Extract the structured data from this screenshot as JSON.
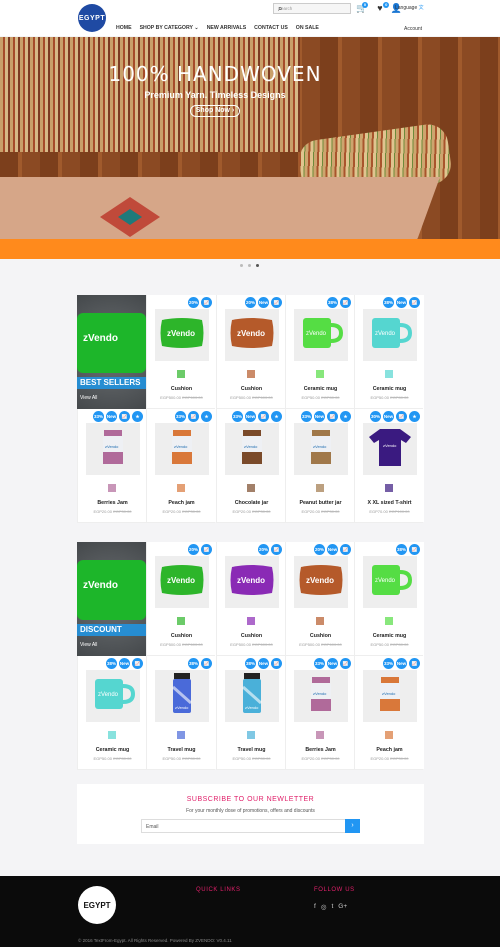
{
  "header": {
    "logo_text": "EGYPT",
    "search_placeholder": "Search",
    "cart_count": "0",
    "wishlist_count": "0",
    "language": "Language",
    "account": "Account",
    "nav": [
      "HOME",
      "SHOP BY CATEGORY ⌄",
      "NEW ARRIVALS",
      "CONTACT US",
      "ON SALE"
    ]
  },
  "hero": {
    "title": "100% HANDWOVEN",
    "subtitle": "Premium Yarn. Timeless Designs",
    "button": "Shop Now ›"
  },
  "colors": {
    "accent": "#2196f3",
    "hero_band": "#ff8a1c",
    "newsletter_title": "#e0206a"
  },
  "sections": [
    {
      "banner_title": "BEST SELLERS",
      "banner_link": "View All",
      "banner_product_text": "zVendo",
      "products": [
        {
          "name": "Cushion",
          "badges": [
            "20%",
            "📈"
          ],
          "price": "EGP500.00",
          "old": "EGP600.00",
          "kind": "cushion",
          "color": "#2db52a"
        },
        {
          "name": "Cushion",
          "badges": [
            "20%",
            "New",
            "📈"
          ],
          "price": "EGP500.00",
          "old": "EGP600.00",
          "kind": "cushion",
          "color": "#b55a2a"
        },
        {
          "name": "Ceramic mug",
          "badges": [
            "38%",
            "📈"
          ],
          "price": "EGP50.00",
          "old": "EGP80.00",
          "kind": "mug",
          "color": "#55dd44"
        },
        {
          "name": "Ceramic mug",
          "badges": [
            "38%",
            "New",
            "📈"
          ],
          "price": "EGP50.00",
          "old": "EGP80.00",
          "kind": "mug",
          "color": "#55d6d0"
        },
        {
          "name": "Berries Jam",
          "badges": [
            "33%",
            "New",
            "📈",
            "★"
          ],
          "price": "EGP20.00",
          "old": "EGP30.00",
          "kind": "jar",
          "color": "#b06a9a"
        },
        {
          "name": "Peach jam",
          "badges": [
            "33%",
            "📈",
            "★"
          ],
          "price": "EGP20.00",
          "old": "EGP30.00",
          "kind": "jar",
          "color": "#d9783a"
        },
        {
          "name": "Chocolate jar",
          "badges": [
            "33%",
            "New",
            "📈",
            "★"
          ],
          "price": "EGP20.00",
          "old": "EGP30.00",
          "kind": "jar",
          "color": "#7a4a2a"
        },
        {
          "name": "Peanut butter jar",
          "badges": [
            "33%",
            "New",
            "📈",
            "★"
          ],
          "price": "EGP20.00",
          "old": "EGP30.00",
          "kind": "jar",
          "color": "#a0784a"
        },
        {
          "name": "X XL sized T-shirt",
          "badges": [
            "30%",
            "New",
            "📈",
            "★"
          ],
          "price": "EGP70.00",
          "old": "EGP100.00",
          "kind": "shirt",
          "color": "#3a1a80"
        }
      ]
    },
    {
      "banner_title": "DISCOUNT",
      "banner_link": "View All",
      "banner_product_text": "zVendo",
      "products": [
        {
          "name": "Cushion",
          "badges": [
            "20%",
            "📈"
          ],
          "price": "EGP500.00",
          "old": "EGP600.00",
          "kind": "cushion",
          "color": "#2db52a"
        },
        {
          "name": "Cushion",
          "badges": [
            "20%",
            "📈"
          ],
          "price": "EGP500.00",
          "old": "EGP600.00",
          "kind": "cushion",
          "color": "#8a2ab5"
        },
        {
          "name": "Cushion",
          "badges": [
            "20%",
            "New",
            "📈"
          ],
          "price": "EGP500.00",
          "old": "EGP600.00",
          "kind": "cushion",
          "color": "#b55a2a"
        },
        {
          "name": "Ceramic mug",
          "badges": [
            "38%",
            "📈"
          ],
          "price": "EGP50.00",
          "old": "EGP80.00",
          "kind": "mug",
          "color": "#55dd44"
        },
        {
          "name": "Ceramic mug",
          "badges": [
            "38%",
            "New",
            "📈"
          ],
          "price": "EGP50.00",
          "old": "EGP80.00",
          "kind": "mug",
          "color": "#55d6d0"
        },
        {
          "name": "Travel mug",
          "badges": [
            "38%",
            "📈"
          ],
          "price": "EGP50.00",
          "old": "EGP80.00",
          "kind": "travel",
          "color": "#4a6ad9"
        },
        {
          "name": "Travel mug",
          "badges": [
            "38%",
            "New",
            "📈"
          ],
          "price": "EGP50.00",
          "old": "EGP80.00",
          "kind": "travel",
          "color": "#4ab0d9"
        },
        {
          "name": "Berries Jam",
          "badges": [
            "33%",
            "New",
            "📈"
          ],
          "price": "EGP20.00",
          "old": "EGP30.00",
          "kind": "jar",
          "color": "#b06a9a"
        },
        {
          "name": "Peach jam",
          "badges": [
            "33%",
            "New",
            "📈"
          ],
          "price": "EGP20.00",
          "old": "EGP30.00",
          "kind": "jar",
          "color": "#d9783a"
        }
      ]
    }
  ],
  "newsletter": {
    "title": "SUBSCRIBE TO OUR NEWLETTER",
    "text": "For your monthly dose of promotions, offers and discounts",
    "placeholder": "Email",
    "button": "›"
  },
  "footer": {
    "logo_text": "EGYPT",
    "quick_links": "QUICK LINKS",
    "follow": "FOLLOW US",
    "social": [
      "f",
      "◎",
      "t",
      "G+"
    ],
    "copyright": "© 2016 TextFrom-Egypt. All Rights Reserved. Powered By ZVENDO: V0.4.11"
  }
}
